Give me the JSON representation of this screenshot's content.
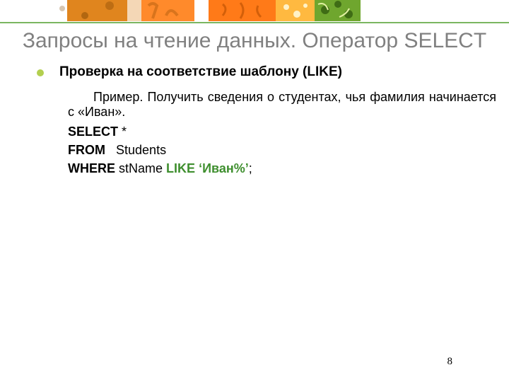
{
  "title": "Запросы на чтение данных. Оператор SELECT",
  "heading": "Проверка на соответствие шаблону (LIKE)",
  "example_text": "Пример. Получить сведения о студентах, чья фамилия начинается с «Иван».",
  "sql": {
    "select_kw": "SELECT",
    "select_cols": "*",
    "from_kw": "FROM",
    "from_tbl": "Students",
    "where_kw": "WHERE",
    "where_col": "stName",
    "like_kw": "LIKE",
    "like_val": "‘Иван%’",
    "terminator": ";"
  },
  "page_number": "8"
}
